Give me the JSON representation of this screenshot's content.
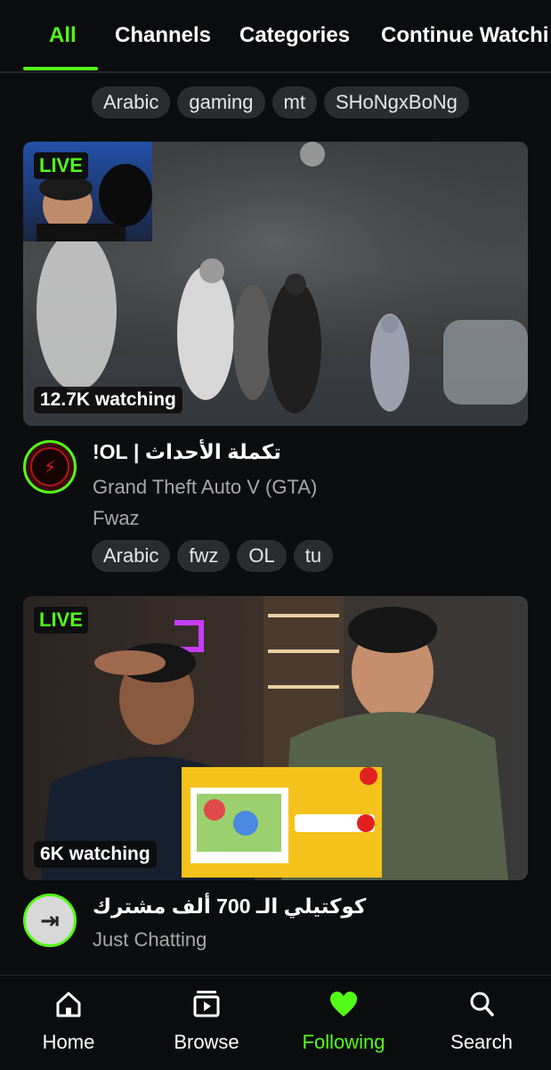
{
  "tabs": [
    {
      "label": "All",
      "active": true
    },
    {
      "label": "Channels",
      "active": false
    },
    {
      "label": "Categories",
      "active": false
    },
    {
      "label": "Continue Watchi",
      "active": false
    }
  ],
  "tag_filters": [
    "Arabic",
    "gaming",
    "mt",
    "SHoNgxBoNg"
  ],
  "streams": [
    {
      "live_label": "LIVE",
      "viewers": "12.7K watching",
      "title": "تكملة الأحداث | OL!",
      "category": "Grand Theft Auto V (GTA)",
      "streamer": "Fwaz",
      "tags": [
        "Arabic",
        "fwz",
        "OL",
        "tu"
      ]
    },
    {
      "live_label": "LIVE",
      "viewers": "6K watching",
      "title": "كوكتيلي الـ 700 ألف مشترك",
      "category": "Just Chatting"
    }
  ],
  "bottom_nav": [
    {
      "label": "Home",
      "icon": "home-icon",
      "active": false
    },
    {
      "label": "Browse",
      "icon": "browse-icon",
      "active": false
    },
    {
      "label": "Following",
      "icon": "heart-icon",
      "active": true
    },
    {
      "label": "Search",
      "icon": "search-icon",
      "active": false
    }
  ],
  "colors": {
    "accent": "#53fc18",
    "background": "#0c0d0e",
    "chip": "#2a2d30",
    "muted_text": "#a8a8a8"
  }
}
